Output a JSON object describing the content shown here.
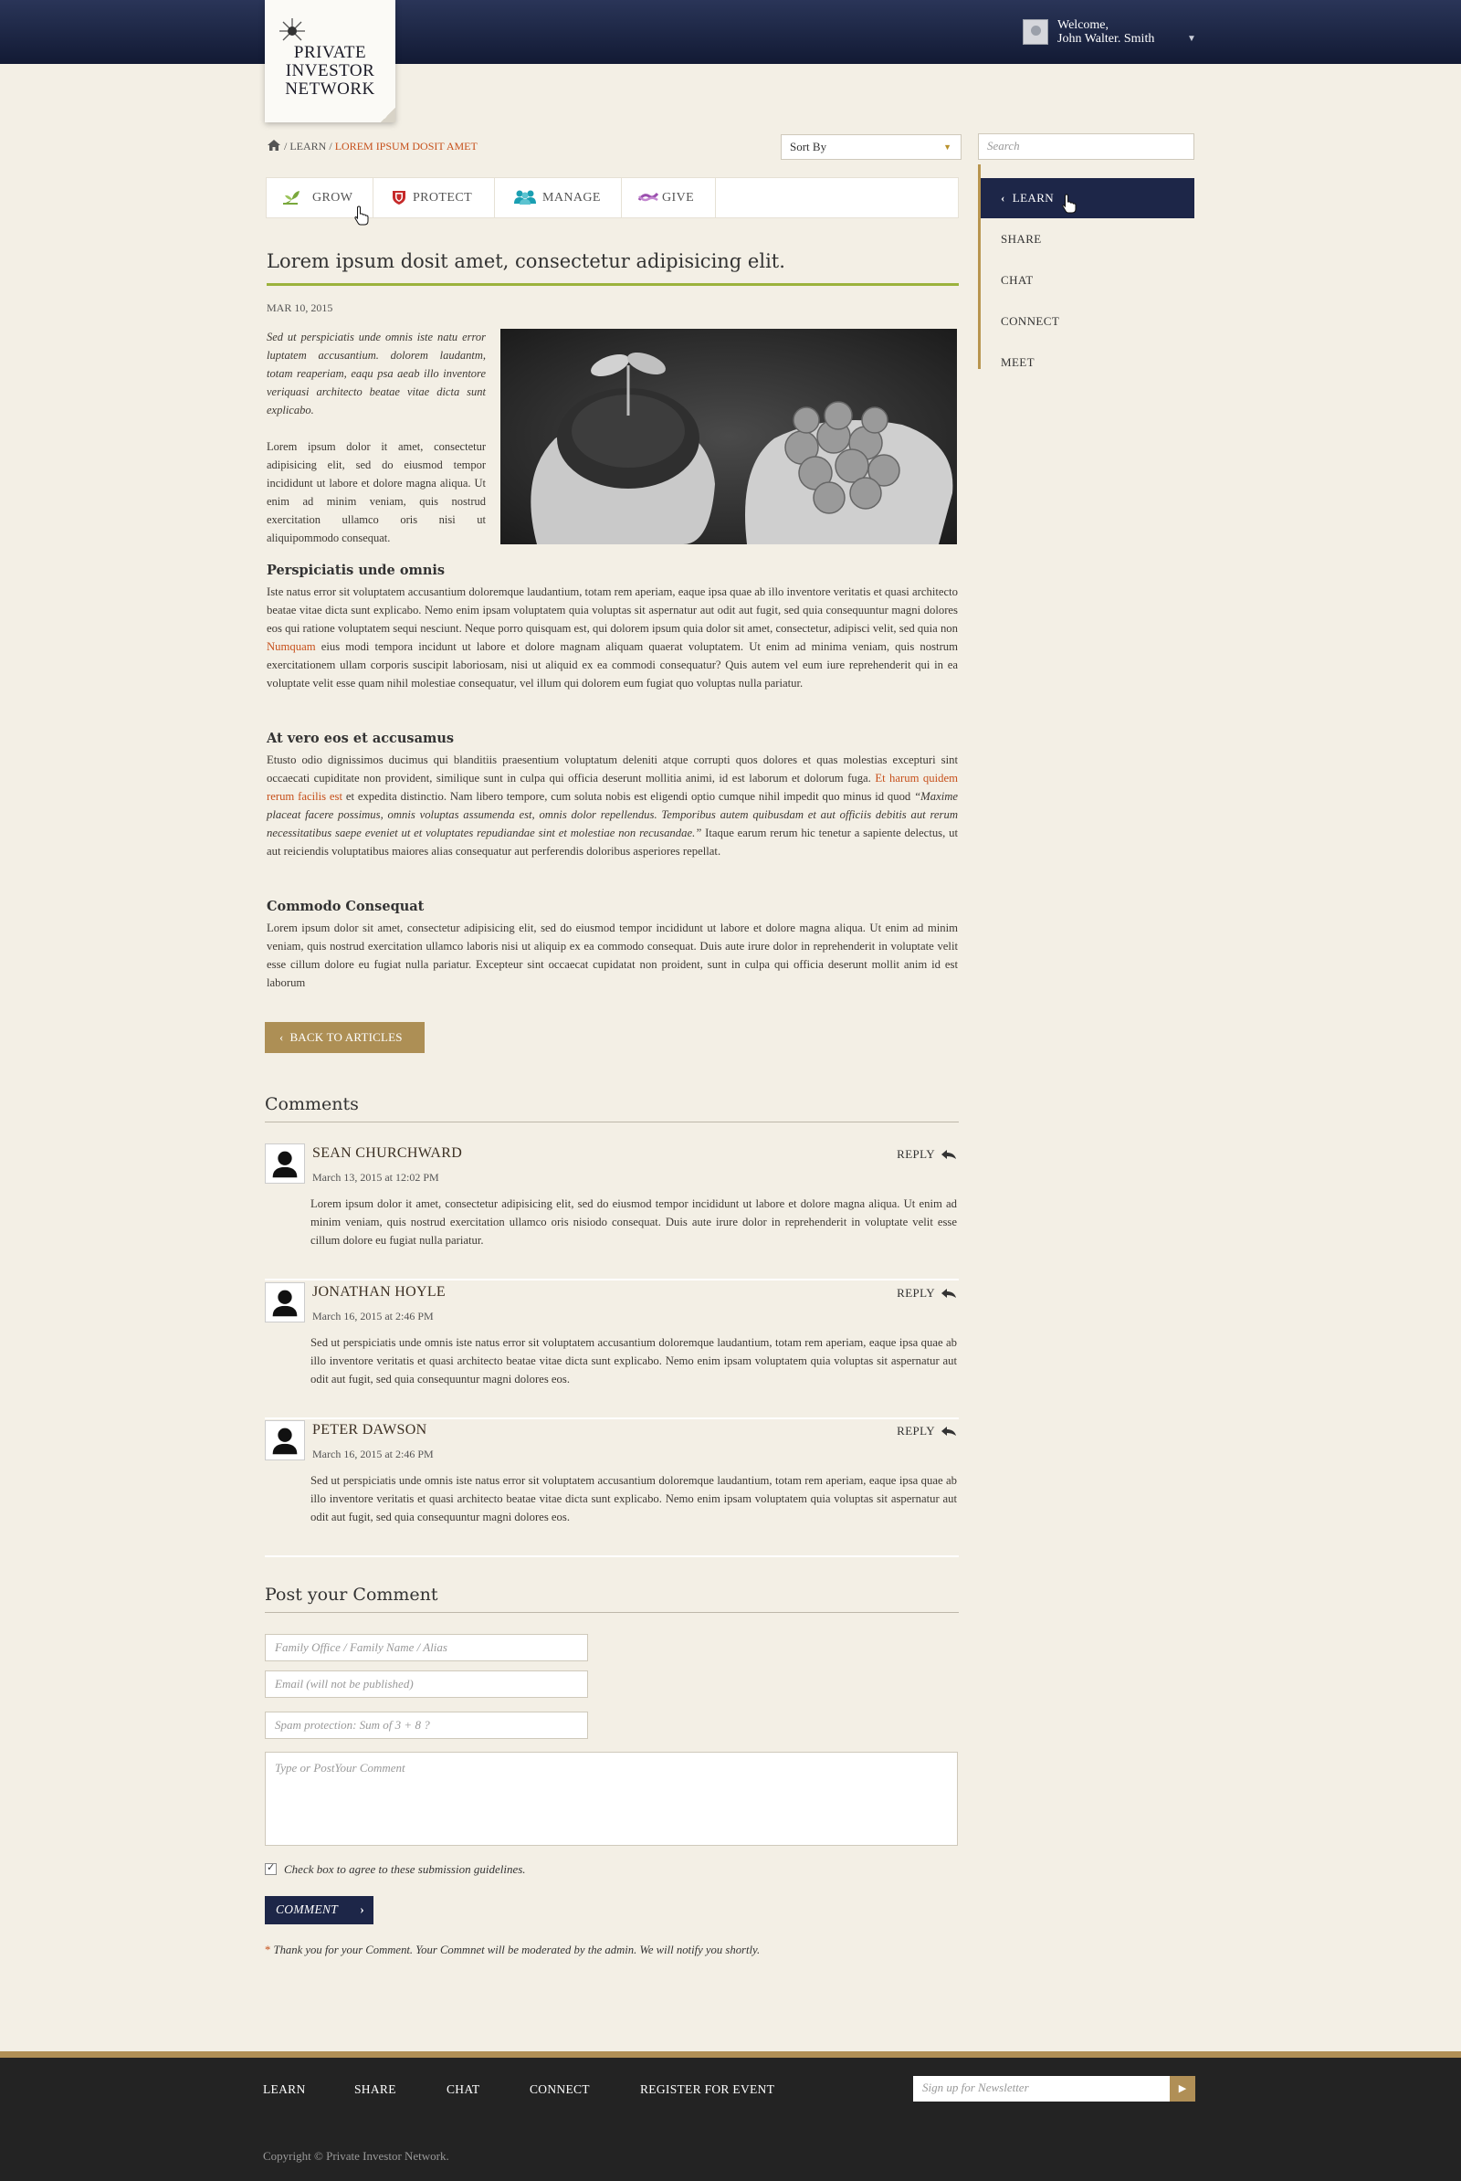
{
  "header": {
    "logo": {
      "line1": "PRIVATE",
      "line2": "INVESTOR",
      "line3": "NETWORK"
    },
    "welcome_label": "Welcome,",
    "user_name": "John Walter. Smith"
  },
  "breadcrumb": {
    "sep": "/",
    "level1": "LEARN",
    "current": "LOREM IPSUM DOSIT AMET"
  },
  "sort": {
    "label": "Sort By"
  },
  "search": {
    "placeholder": "Search"
  },
  "categories": [
    {
      "label": "GROW",
      "color": "#79a83c"
    },
    {
      "label": "PROTECT",
      "color": "#c62a2a"
    },
    {
      "label": "MANAGE",
      "color": "#1a9fb2"
    },
    {
      "label": "GIVE",
      "color": "#9b4fae"
    }
  ],
  "sidebar": [
    "LEARN",
    "SHARE",
    "CHAT",
    "CONNECT",
    "MEET"
  ],
  "article": {
    "title": "Lorem ipsum dosit amet, consectetur adipisicing elit.",
    "date": "MAR 10, 2015",
    "intro_italic": "Sed ut perspiciatis unde omnis iste natu error luptatem accusantium. dolorem laudantm, totam reaperiam, eaqu psa aeab illo inventore veriquasi architecto beatae vitae dicta sunt explicabo.",
    "intro_plain": "Lorem ipsum dolor it amet, consectetur adipisicing elit, sed do eiusmod tempor incididunt ut labore et dolore magna aliqua. Ut enim ad minim veniam, quis nostrud exercitation ullamco oris nisi ut aliquipommodo consequat.",
    "s1_heading": "Perspiciatis unde omnis",
    "s1_a": "Iste natus error sit voluptatem accusantium doloremque laudantium, totam rem aperiam, eaque ipsa quae ab illo inventore veritatis et quasi architecto beatae vitae dicta sunt explicabo. Nemo enim ipsam voluptatem quia voluptas sit aspernatur aut odit aut fugit, sed quia consequuntur magni dolores eos qui ratione voluptatem sequi nesciunt. Neque porro quisquam est, qui dolorem ipsum quia dolor sit amet, consectetur, adipisci velit, sed quia non",
    "s1_link": "Numquam",
    "s1_b": "eius modi tempora incidunt ut labore et dolore magnam aliquam quaerat voluptatem. Ut enim ad minima veniam, quis nostrum exercitationem ullam corporis suscipit laboriosam, nisi ut aliquid ex ea commodi consequatur? Quis autem vel eum iure reprehenderit qui in ea voluptate velit esse quam nihil molestiae consequatur, vel illum qui dolorem eum fugiat quo voluptas nulla pariatur.",
    "s2_heading": "At vero eos et accusamus",
    "s2_a": "Etusto odio dignissimos ducimus qui blanditiis praesentium voluptatum deleniti atque corrupti quos dolores et quas molestias excepturi sint occaecati cupiditate non provident, similique sunt in culpa qui officia deserunt mollitia animi, id est laborum et dolorum fuga.",
    "s2_link": "Et harum quidem rerum facilis est",
    "s2_b": "et expedita distinctio. Nam libero tempore, cum soluta nobis est eligendi optio cumque nihil impedit quo minus id quod",
    "s2_quote": "“Maxime placeat facere possimus, omnis voluptas assumenda est, omnis dolor repellendus. Temporibus autem quibusdam et aut officiis debitis aut rerum necessitatibus saepe eveniet ut et voluptates repudiandae sint et molestiae non recusandae.”",
    "s2_c": "Itaque earum rerum hic tenetur a sapiente delectus, ut aut reiciendis voluptatibus maiores alias consequatur aut perferendis doloribus asperiores repellat.",
    "s3_heading": "Commodo Consequat",
    "s3": "Lorem ipsum dolor sit amet, consectetur adipisicing elit, sed do eiusmod tempor incididunt ut labore et dolore magna aliqua. Ut enim ad minim veniam, quis nostrud exercitation ullamco laboris nisi ut aliquip ex ea commodo consequat. Duis aute irure dolor in reprehenderit in voluptate velit esse cillum dolore eu fugiat nulla pariatur. Excepteur sint occaecat cupidatat non proident, sunt in culpa qui officia deserunt mollit anim id est laborum",
    "back_label": "BACK TO ARTICLES"
  },
  "comments": {
    "heading": "Comments",
    "reply_label": "REPLY",
    "items": [
      {
        "name": "SEAN CHURCHWARD",
        "date": "March 13, 2015 at 12:02 PM",
        "body": "Lorem ipsum dolor it amet, consectetur adipisicing elit, sed do eiusmod tempor incididunt ut labore et dolore magna aliqua. Ut enim ad minim veniam, quis nostrud exercitation ullamco  oris nisiodo consequat. Duis aute irure dolor in reprehenderit in voluptate velit esse cillum dolore eu fugiat nulla pariatur."
      },
      {
        "name": "JONATHAN HOYLE",
        "date": "March 16, 2015 at 2:46 PM",
        "body": "Sed ut perspiciatis unde omnis iste natus error sit voluptatem accusantium doloremque laudantium, totam rem aperiam, eaque ipsa quae ab illo inventore veritatis et quasi architecto beatae vitae dicta sunt explicabo. Nemo enim ipsam voluptatem quia voluptas sit aspernatur aut odit aut fugit, sed quia consequuntur magni dolores eos."
      },
      {
        "name": "PETER DAWSON",
        "date": "March 16, 2015 at 2:46 PM",
        "body": "Sed ut perspiciatis unde omnis iste natus error sit voluptatem accusantium doloremque laudantium, totam rem aperiam, eaque ipsa quae ab illo inventore veritatis et quasi architecto beatae vitae dicta sunt explicabo. Nemo enim ipsam voluptatem quia voluptas sit aspernatur aut odit aut fugit, sed quia consequuntur magni dolores eos."
      }
    ]
  },
  "post_form": {
    "heading": "Post your Comment",
    "name_placeholder": "Family Office / Family Name  /  Alias",
    "email_placeholder": "Email  (will not be published)",
    "spam_placeholder": "Spam protection: Sum of 3 + 8 ?",
    "comment_placeholder": "Type or PostYour Comment",
    "agree_label": "Check box to agree to these submission guidelines.",
    "submit_label": "COMMENT",
    "note_star": "*",
    "note": "Thank you for your Comment. Your Commnet will be moderated  by the admin. We will notify you shortly."
  },
  "footer": {
    "links": [
      "LEARN",
      "SHARE",
      "CHAT",
      "CONNECT",
      "REGISTER FOR EVENT"
    ],
    "newsletter_placeholder": "Sign up for Newsletter",
    "copyright": "Copyright © Private Investor Network."
  }
}
